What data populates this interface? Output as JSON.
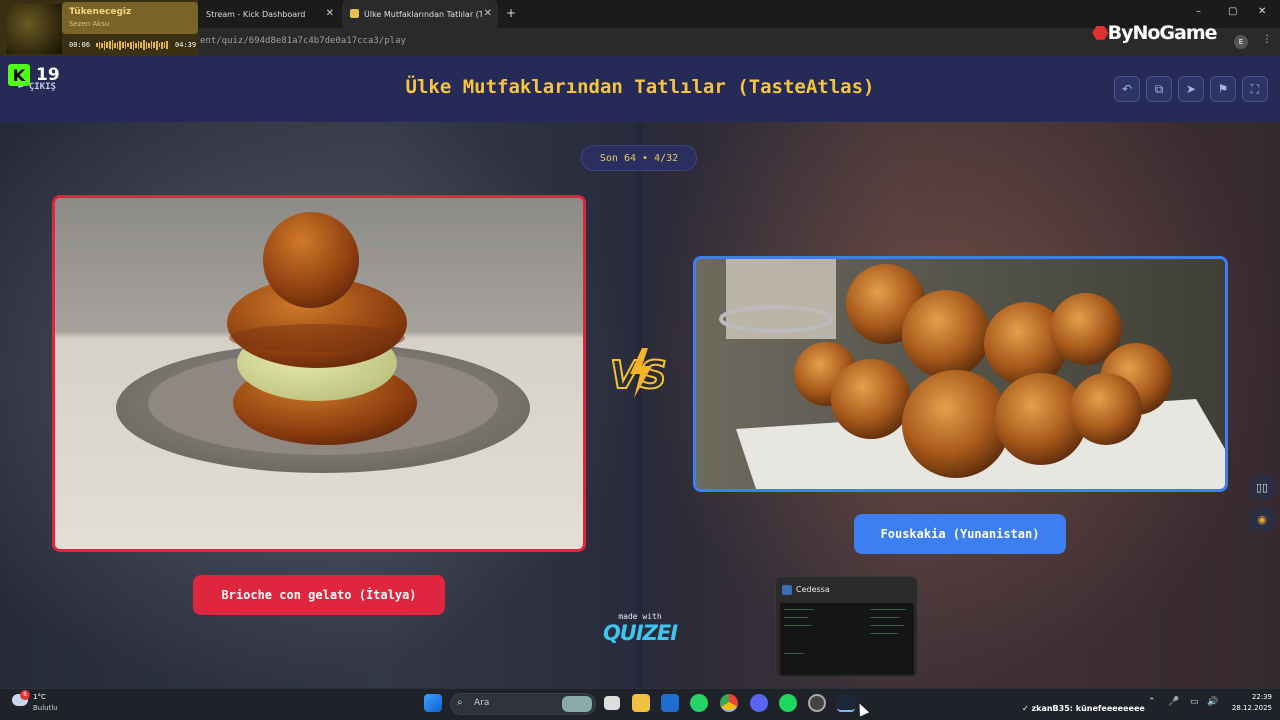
{
  "browser": {
    "tabs": [
      {
        "label": "Stream - Kick Dashboard"
      },
      {
        "label": "Ülke Mutfaklarından Tatlılar (Ta"
      }
    ],
    "new_tab_symbol": "+",
    "url": "ent/quiz/694d8e81a7c4b7de0a17cca3/play",
    "window_controls": [
      "–",
      "▢",
      "✕"
    ]
  },
  "media": {
    "title": "Tükenecegiz",
    "artist": "Sezen Aksu",
    "elapsed": "00:06",
    "duration": "04:39",
    "accent": "#e2b64a"
  },
  "kick": {
    "viewer_count": "19",
    "logo_letter": "K",
    "brand_color": "#53fc18"
  },
  "overlay_brand": {
    "mark": "⬣",
    "name": "ByNoGame"
  },
  "header": {
    "exit_label": "← ÇIKIŞ",
    "title": "Ülke Mutfaklarından Tatlılar (TasteAtlas)",
    "title_color": "#f5c542",
    "buttons": [
      {
        "icon": "undo-icon",
        "glyph": "↶"
      },
      {
        "icon": "copy-icon",
        "glyph": "⧉"
      },
      {
        "icon": "send-icon",
        "glyph": "➤"
      },
      {
        "icon": "flag-icon",
        "glyph": "⚑"
      },
      {
        "icon": "fullscreen-icon",
        "glyph": "⛶"
      }
    ]
  },
  "round": {
    "label": "Son 64 • 4/32"
  },
  "matchup": {
    "left": {
      "name": "Brioche con gelato (İtalya)",
      "accent": "#e0263e"
    },
    "right": {
      "name": "Fouskakia (Yunanistan)",
      "accent": "#3d7ef0"
    },
    "vs_text": "VS"
  },
  "made_with": {
    "line1": "made with",
    "brand": "QUIZEI"
  },
  "side_buttons": [
    {
      "icon": "book-icon",
      "glyph": "▯▯"
    },
    {
      "icon": "chrome-extension-icon",
      "glyph": "◉"
    }
  ],
  "preview": {
    "title": "Cedessa"
  },
  "taskbar": {
    "weather": {
      "temp": "1°C",
      "condition": "Bulutlu",
      "badge": "6"
    },
    "search_label": "Ara",
    "user": "✓ zkanB35: künefeeeeeeee",
    "time": "22:39",
    "date": "28.12.2025",
    "tray_icons": [
      "⌃",
      "🎤",
      "▭",
      "🔊"
    ]
  }
}
